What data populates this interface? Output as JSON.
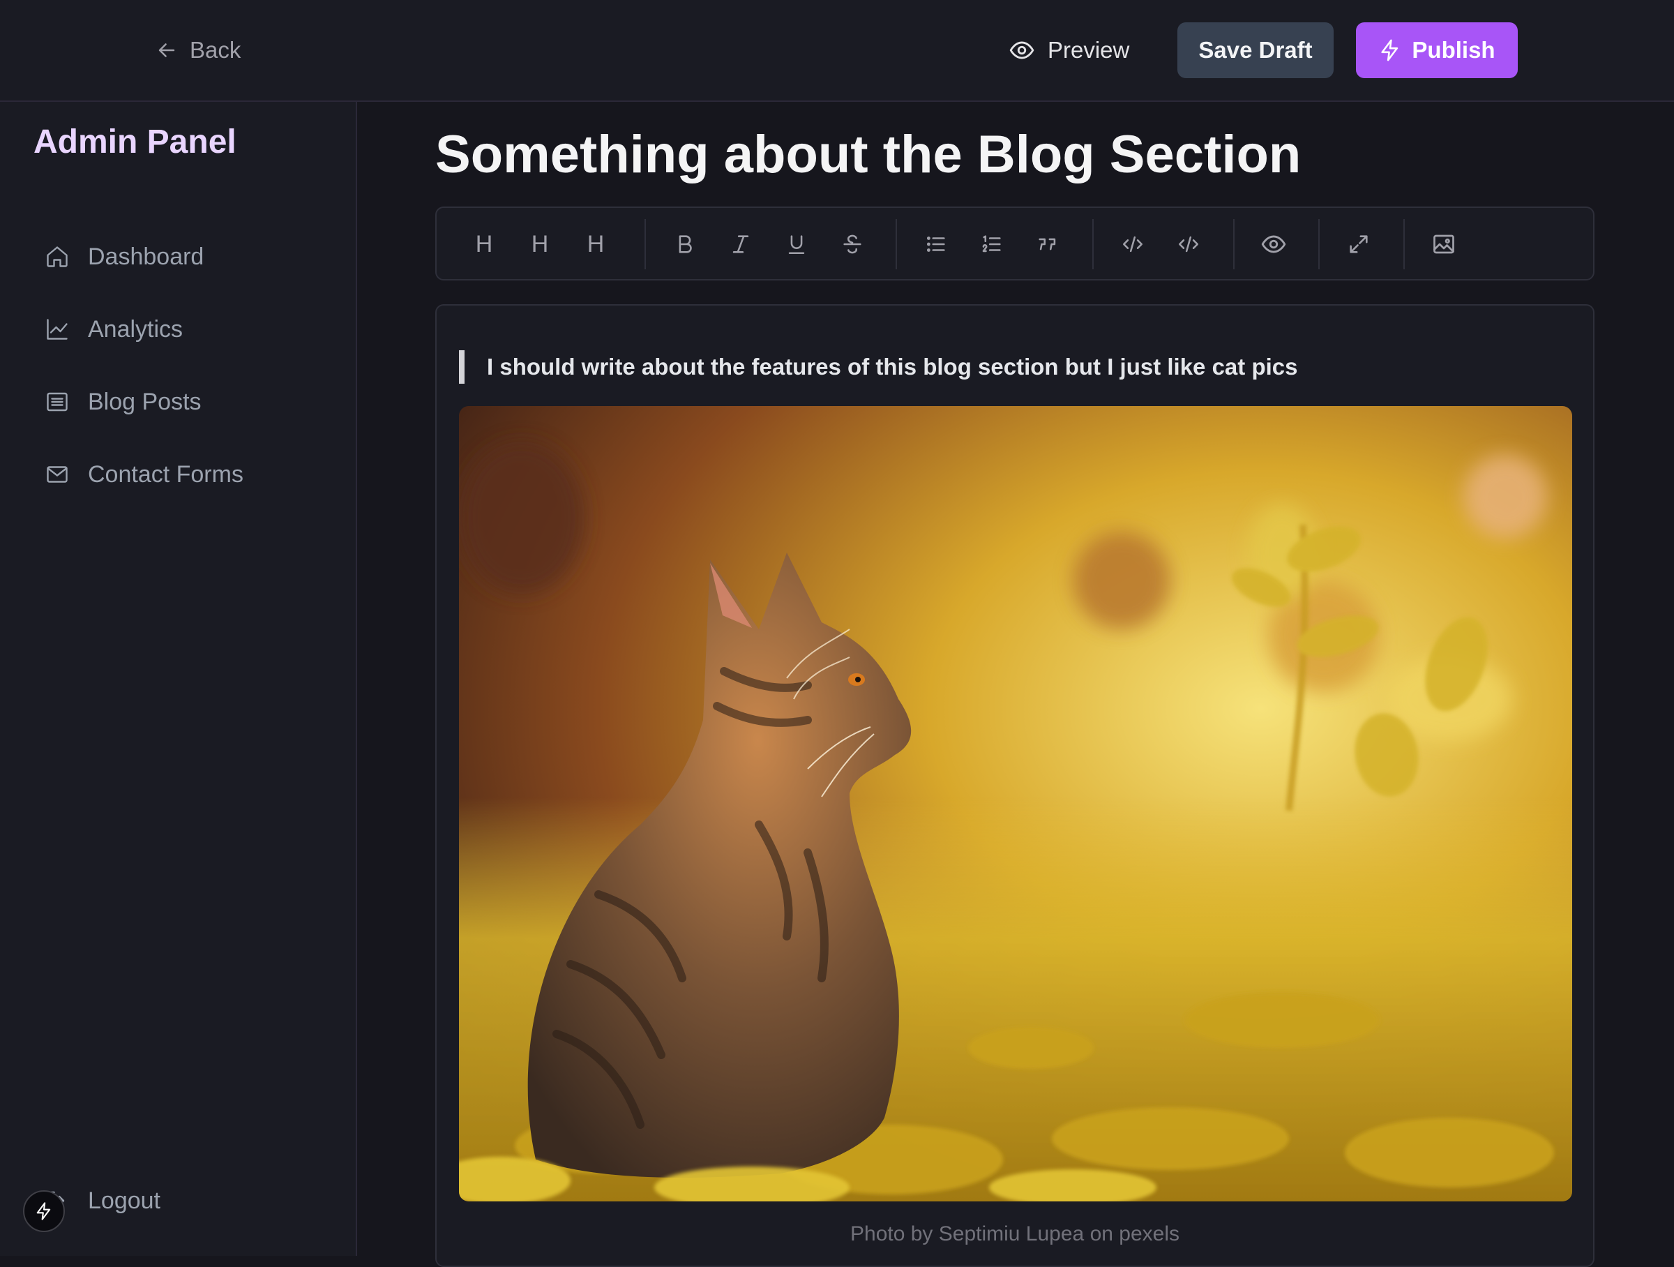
{
  "topbar": {
    "back_label": "Back",
    "preview_label": "Preview",
    "save_label": "Save Draft",
    "publish_label": "Publish",
    "publish_color": "#a855f7",
    "save_color": "#374151"
  },
  "sidebar": {
    "brand": "Admin Panel",
    "brand_color": "#e9d5ff",
    "items": [
      {
        "label": "Dashboard",
        "icon": "home-icon"
      },
      {
        "label": "Analytics",
        "icon": "chart-line-icon"
      },
      {
        "label": "Blog Posts",
        "icon": "list-icon"
      },
      {
        "label": "Contact Forms",
        "icon": "mail-icon"
      }
    ],
    "logout_label": "Logout",
    "logout_icon": "logout-icon"
  },
  "post": {
    "title": "Something about the Blog Section",
    "quote": "I should write about the features of this blog section but I just like cat pics",
    "image_caption": "Photo by Septimiu Lupea on pexels",
    "image_subject": "tabby kitten in sunlit yellow grass"
  },
  "toolbar": {
    "buttons": [
      {
        "label": "H",
        "icon": "heading-1-icon"
      },
      {
        "label": "H",
        "icon": "heading-2-icon"
      },
      {
        "label": "H",
        "icon": "heading-3-icon"
      },
      {
        "icon": "bold-icon"
      },
      {
        "icon": "italic-icon"
      },
      {
        "icon": "underline-icon"
      },
      {
        "icon": "strikethrough-icon"
      },
      {
        "icon": "bullet-list-icon"
      },
      {
        "icon": "ordered-list-icon"
      },
      {
        "icon": "quote-icon"
      },
      {
        "icon": "code-icon"
      },
      {
        "icon": "code-block-icon"
      },
      {
        "icon": "preview-icon"
      },
      {
        "icon": "fullscreen-icon"
      },
      {
        "icon": "image-icon"
      }
    ]
  }
}
